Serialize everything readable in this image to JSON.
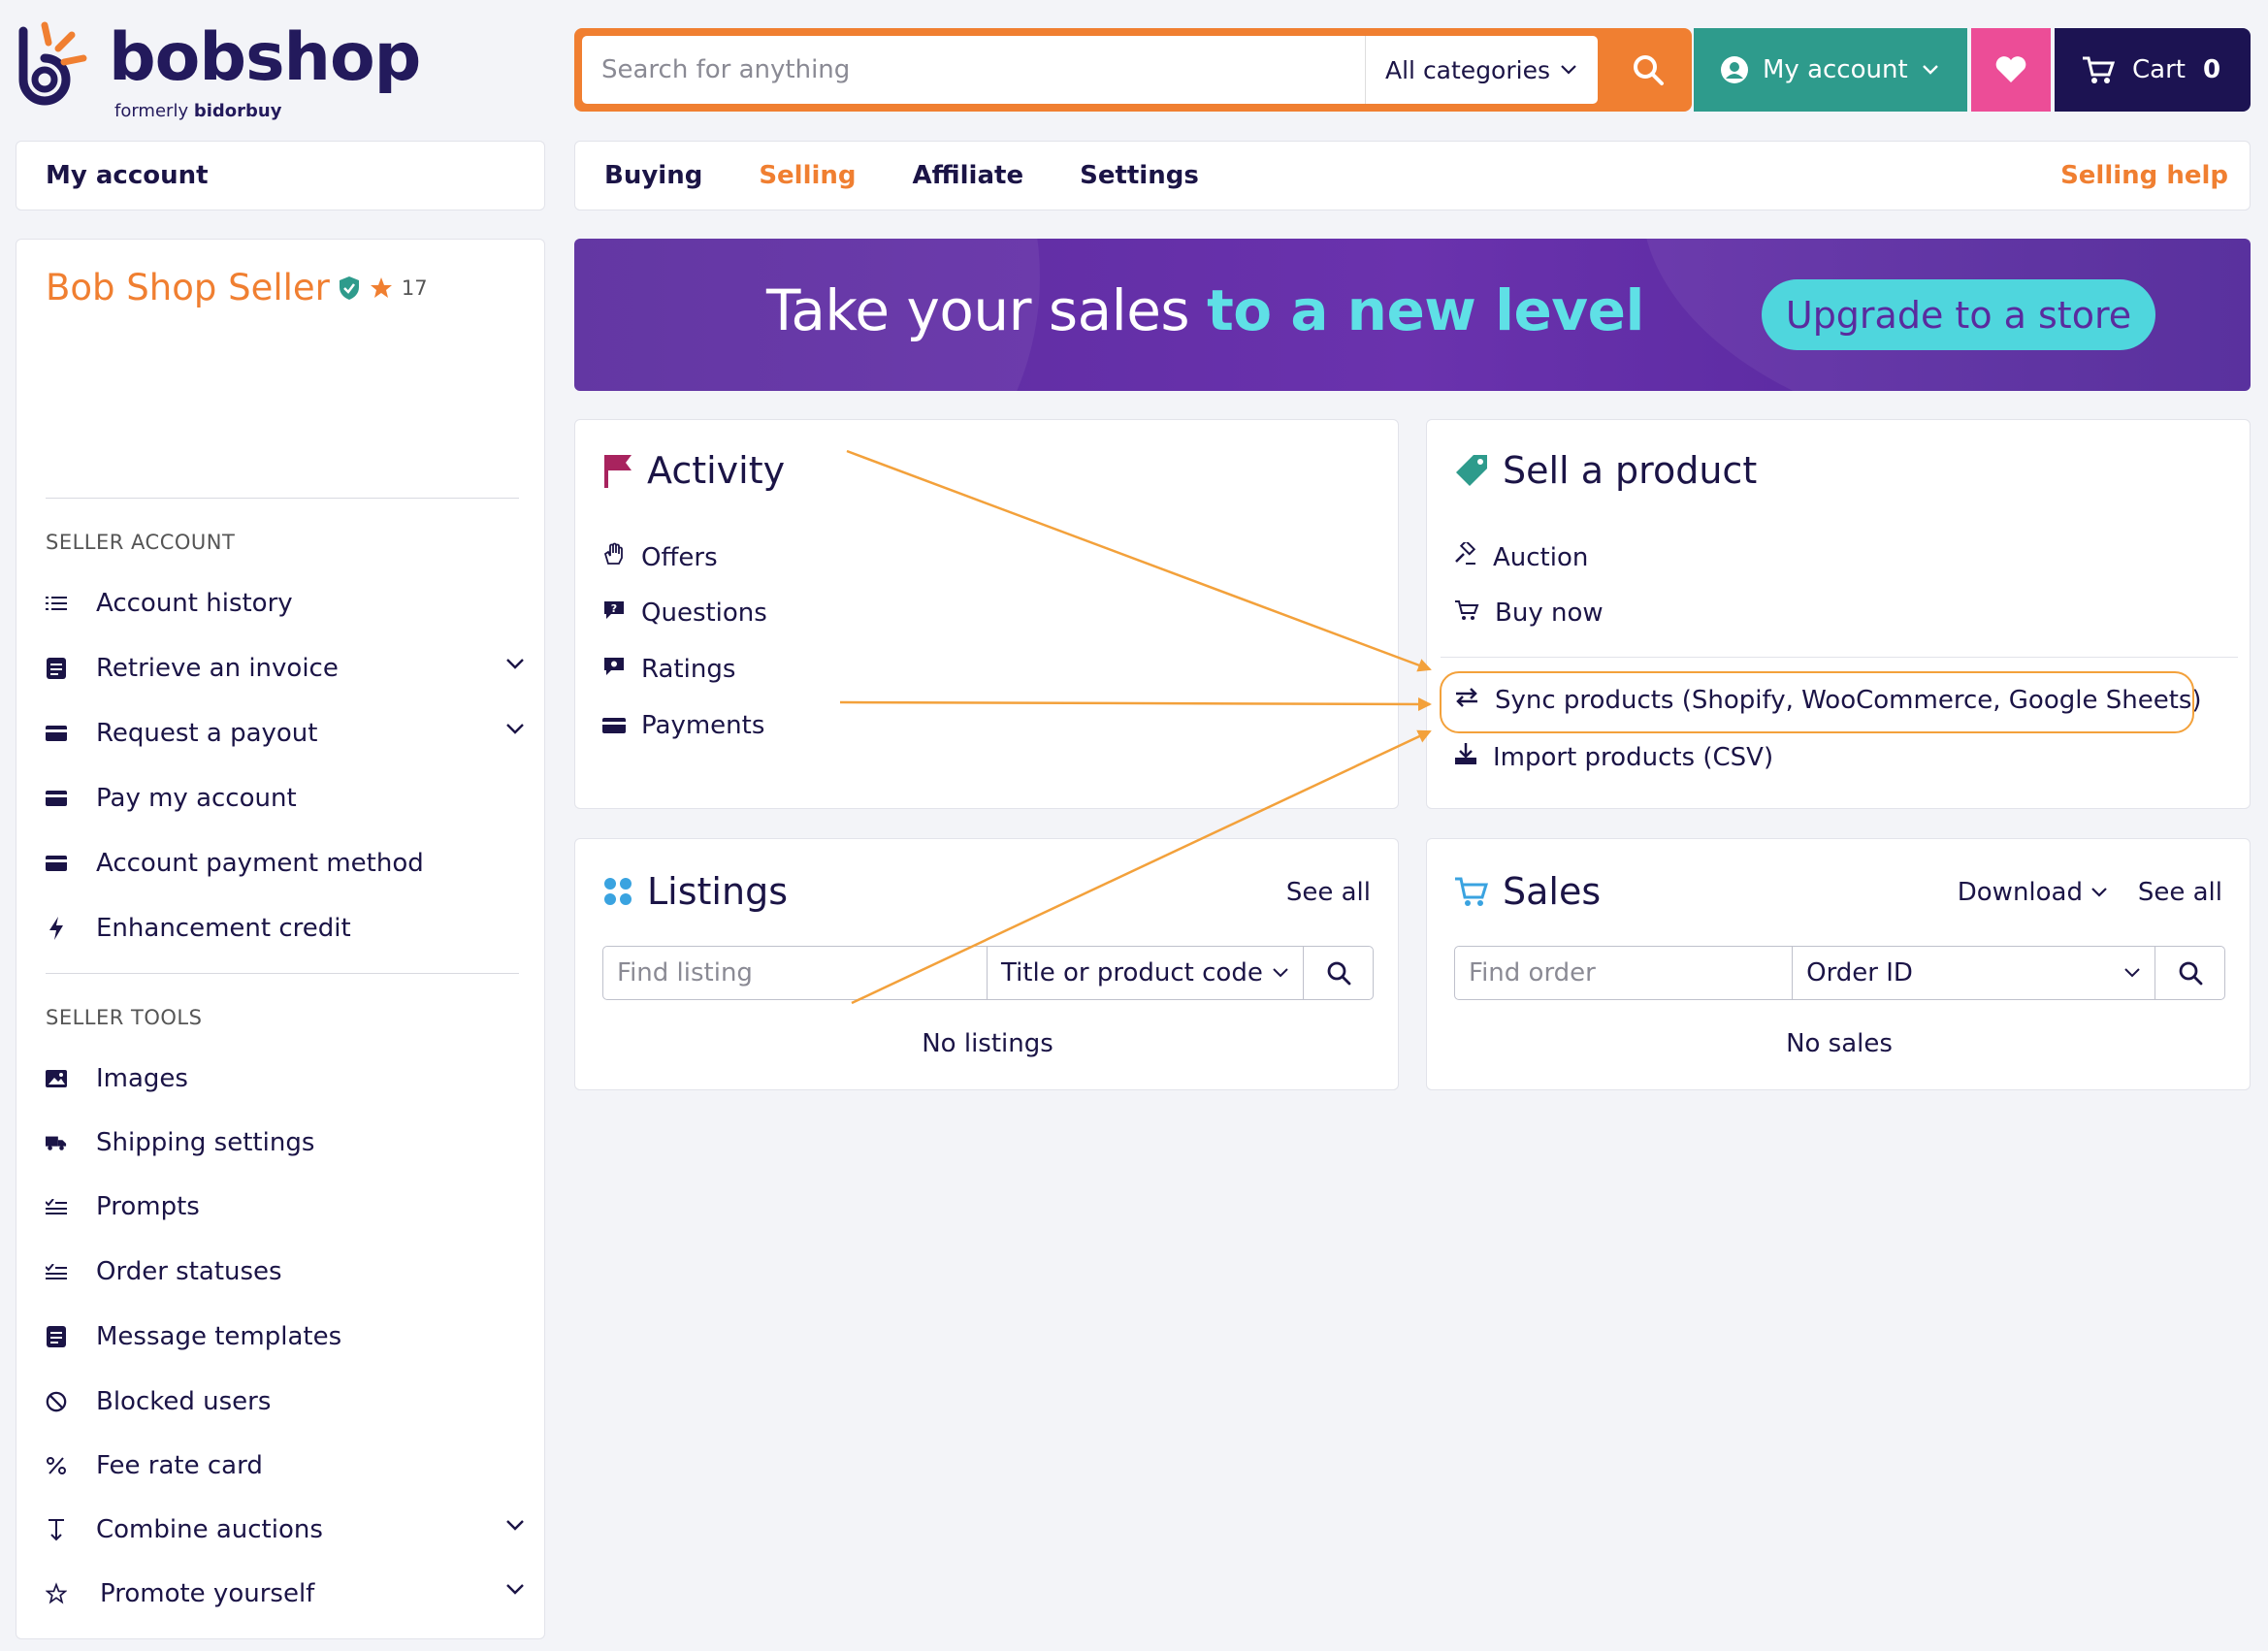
{
  "brand": {
    "name": "bobshop",
    "formerly_prefix": "formerly",
    "formerly_name": "bidorbuy"
  },
  "colors": {
    "accent": "#f07f31",
    "navy": "#1c1352",
    "teal": "#2e9b8c",
    "pink": "#ec4d97",
    "banner": "#5a2b9e",
    "highlight": "#f3a13b"
  },
  "header": {
    "search_placeholder": "Search for anything",
    "category": "All categories",
    "account_label": "My account",
    "cart_label": "Cart",
    "cart_count": "0"
  },
  "sidebar": {
    "heading": "My account",
    "seller_name": "Bob Shop Seller",
    "rating": "17",
    "seller_account_heading": "SELLER ACCOUNT",
    "seller_account": [
      {
        "label": "Account history",
        "icon": "list-icon"
      },
      {
        "label": "Retrieve an invoice",
        "icon": "invoice-icon",
        "expandable": true
      },
      {
        "label": "Request a payout",
        "icon": "card-icon",
        "expandable": true
      },
      {
        "label": "Pay my account",
        "icon": "card-icon"
      },
      {
        "label": "Account payment method",
        "icon": "card-icon"
      },
      {
        "label": "Enhancement credit",
        "icon": "bolt-icon"
      }
    ],
    "seller_tools_heading": "SELLER TOOLS",
    "seller_tools": [
      {
        "label": "Images",
        "icon": "image-icon"
      },
      {
        "label": "Shipping settings",
        "icon": "truck-icon"
      },
      {
        "label": "Prompts",
        "icon": "checklist-icon"
      },
      {
        "label": "Order statuses",
        "icon": "checklist-icon"
      },
      {
        "label": "Message templates",
        "icon": "template-icon"
      },
      {
        "label": "Blocked users",
        "icon": "blocked-icon"
      },
      {
        "label": "Fee rate card",
        "icon": "percent-icon"
      },
      {
        "label": "Combine auctions",
        "icon": "merge-icon",
        "expandable": true
      },
      {
        "label": "Promote yourself",
        "icon": "star-icon",
        "expandable": true
      }
    ]
  },
  "tabs": {
    "items": [
      "Buying",
      "Selling",
      "Affiliate",
      "Settings"
    ],
    "active": "Selling",
    "help": "Selling help"
  },
  "banner": {
    "text_plain": "Take your sales ",
    "text_highlight": "to a new level",
    "button": "Upgrade to a store"
  },
  "activity": {
    "title": "Activity",
    "items": [
      {
        "label": "Offers",
        "icon": "hand-icon"
      },
      {
        "label": "Questions",
        "icon": "question-bubble-icon"
      },
      {
        "label": "Ratings",
        "icon": "rating-bubble-icon"
      },
      {
        "label": "Payments",
        "icon": "card-icon"
      }
    ]
  },
  "sell": {
    "title": "Sell a product",
    "items": [
      {
        "label": "Auction",
        "icon": "gavel-icon"
      },
      {
        "label": "Buy now",
        "icon": "cart-icon"
      }
    ],
    "sync": "Sync products (Shopify, WooCommerce, Google Sheets)",
    "import": "Import products (CSV)"
  },
  "listings": {
    "title": "Listings",
    "see_all": "See all",
    "placeholder": "Find listing",
    "filter": "Title or product code",
    "empty": "No listings"
  },
  "sales": {
    "title": "Sales",
    "download": "Download",
    "see_all": "See all",
    "placeholder": "Find order",
    "filter": "Order ID",
    "empty": "No sales"
  }
}
